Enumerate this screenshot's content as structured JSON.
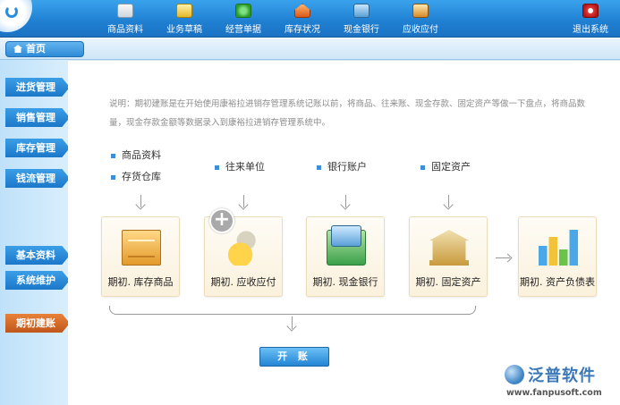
{
  "nav": {
    "items": [
      {
        "label": "商品资料",
        "icon": "product-data-icon"
      },
      {
        "label": "业务草稿",
        "icon": "business-draft-icon"
      },
      {
        "label": "经营单据",
        "icon": "operation-doc-icon"
      },
      {
        "label": "库存状况",
        "icon": "stock-status-icon"
      },
      {
        "label": "现金银行",
        "icon": "cash-bank-icon"
      },
      {
        "label": "应收应付",
        "icon": "receivable-payable-icon"
      }
    ],
    "exit_label": "退出系统"
  },
  "home_tab": {
    "label": "首页"
  },
  "sidebar": {
    "items": [
      {
        "label": "进货管理"
      },
      {
        "label": "销售管理"
      },
      {
        "label": "库存管理"
      },
      {
        "label": "钱流管理"
      },
      {
        "label": "基本资料"
      },
      {
        "label": "系统维护"
      },
      {
        "label": "期初建账",
        "active": true
      }
    ]
  },
  "main": {
    "description": "说明：期初建账是在开始使用康裕拉进销存管理系统记账以前，将商品、往来账、现金存款、固定资产等做一下盘点，将商品数量，现金存款金额等数据录入到康裕拉进销存管理系统中。",
    "bullets": {
      "goods": "商品资料",
      "warehouse": "存货仓库",
      "partners": "往来单位",
      "bank_accounts": "银行账户",
      "fixed_assets": "固定资产"
    },
    "cards": [
      {
        "label": "期初. 库存商品",
        "icon": "inventory-goods-icon"
      },
      {
        "label": "期初. 应收应付",
        "icon": "receivable-payable-icon"
      },
      {
        "label": "期初. 现金银行",
        "icon": "cash-bank-icon"
      },
      {
        "label": "期初. 固定资产",
        "icon": "fixed-assets-icon"
      },
      {
        "label": "期初. 资产负债表",
        "icon": "balance-sheet-icon"
      }
    ],
    "open_button": "开 账"
  },
  "brand": {
    "name": "泛普软件",
    "url": "www.fanpusoft.com"
  },
  "colors": {
    "topbar": "#1f7fd1",
    "sidebar_item": "#1c78c9",
    "sidebar_active": "#c0561a",
    "card_bg": "#fbf1dc"
  }
}
